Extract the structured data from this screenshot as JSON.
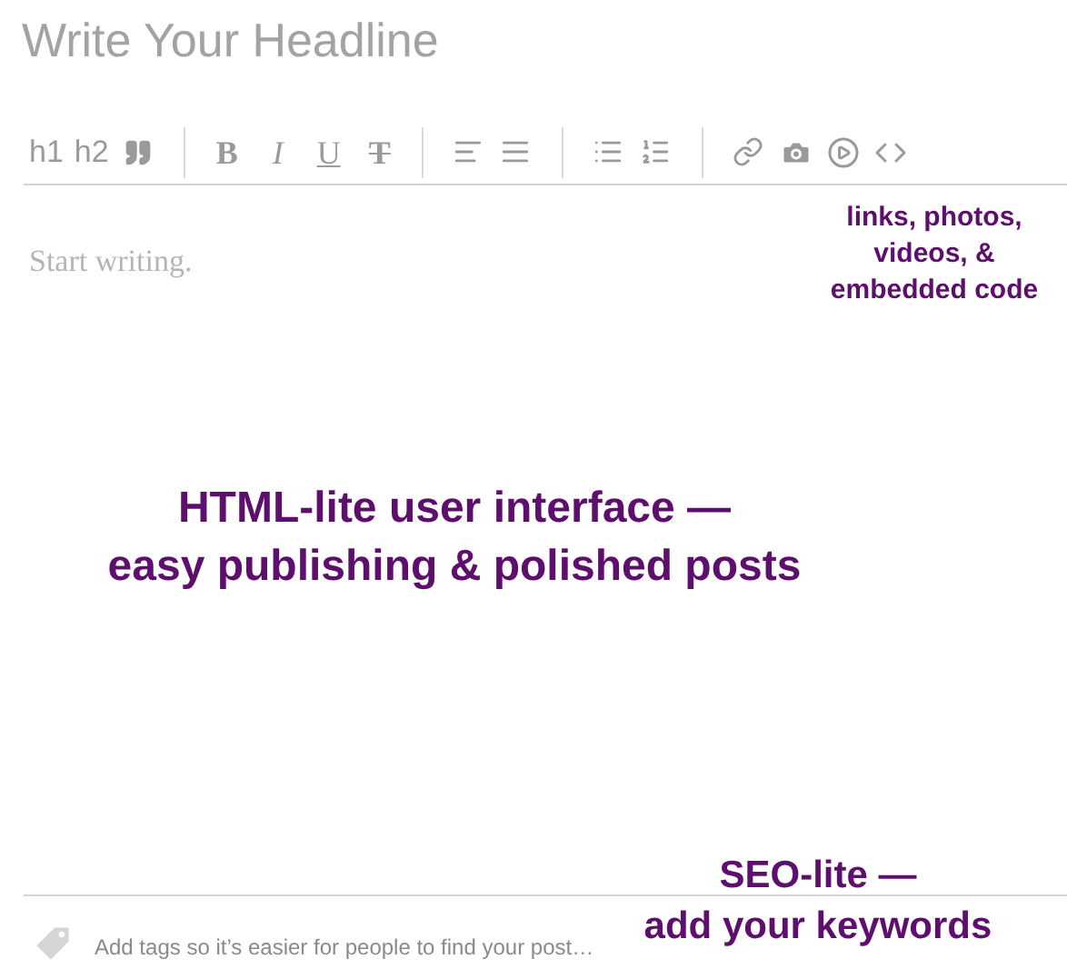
{
  "headline": {
    "placeholder": "Write Your Headline"
  },
  "toolbar": {
    "heading_buttons": [
      "h1",
      "h2"
    ],
    "format_buttons": [
      "B",
      "I",
      "U",
      "T"
    ]
  },
  "body": {
    "placeholder": "Start writing."
  },
  "tags": {
    "placeholder": "Add tags so it’s easier for people to find your post…"
  },
  "annotations": [
    {
      "kind": "toolbar",
      "lines": [
        "links, photos,",
        "videos, &",
        "embedded code"
      ]
    },
    {
      "kind": "center",
      "lines": [
        "HTML-lite user interface —",
        "easy publishing & polished posts"
      ]
    },
    {
      "kind": "tags",
      "lines": [
        "SEO-lite —",
        "add your keywords"
      ]
    }
  ]
}
